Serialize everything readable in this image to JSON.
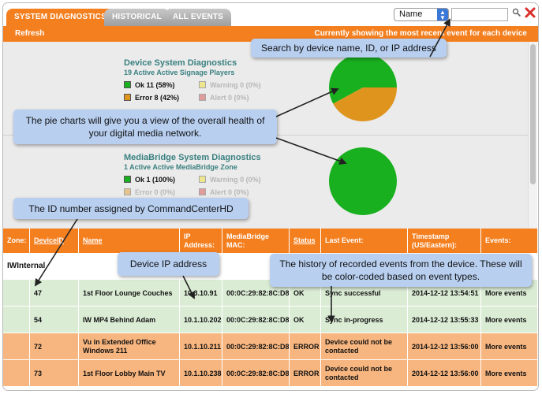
{
  "tabs": [
    {
      "label": "SYSTEM DIAGNOSTICS",
      "active": true
    },
    {
      "label": "HISTORICAL",
      "active": false
    },
    {
      "label": "ALL EVENTS",
      "active": false
    }
  ],
  "search": {
    "filter_selected": "Name",
    "value": ""
  },
  "toolbar": {
    "refresh_label": "Refresh",
    "showing_text": "Currently showing the most recent event for each device"
  },
  "device_diagnostics": {
    "title": "Device System Diagnostics",
    "subtitle": "19 Active Active Signage Players",
    "legend": [
      {
        "label": "Ok 11 (58%)",
        "color": "#19b01f"
      },
      {
        "label": "Warning 0 (0%)",
        "color": "#f3e21a"
      },
      {
        "label": "Error 8 (42%)",
        "color": "#df941d"
      },
      {
        "label": "Alert 0 (0%)",
        "color": "#d33b3b"
      }
    ],
    "pie": [
      {
        "name": "Ok",
        "value": 11,
        "color": "#19b01f"
      },
      {
        "name": "Error",
        "value": 8,
        "color": "#df941d"
      }
    ]
  },
  "mediabridge_diagnostics": {
    "title": "MediaBridge System Diagnostics",
    "subtitle": "1 Active Active MediaBridge Zone",
    "legend": [
      {
        "label": "Ok 1 (100%)",
        "color": "#19b01f"
      },
      {
        "label": "Warning 0 (0%)",
        "color": "#f3e21a"
      },
      {
        "label": "Error 0 (0%)",
        "color": "#df941d"
      },
      {
        "label": "Alert 0 (0%)",
        "color": "#d33b3b"
      }
    ],
    "pie": [
      {
        "name": "Ok",
        "value": 1,
        "color": "#19b01f"
      }
    ]
  },
  "table": {
    "headers": [
      "Zone:",
      "DeviceID",
      "Name",
      "IP Address:",
      "MediaBridge MAC:",
      "Status",
      "Last Event:",
      "Timestamp (US/Eastern):",
      "Events:"
    ],
    "zone": "IWInternal",
    "rows": [
      {
        "id": "47",
        "name": "1st Floor Lounge Couches",
        "ip": "10.3.10.91",
        "mac": "00:0C:29:82:8C:D8",
        "status": "OK",
        "event": "Sync successful",
        "timestamp": "2014-12-12 13:54:51",
        "events": "More events"
      },
      {
        "id": "54",
        "name": "IW MP4 Behind Adam",
        "ip": "10.1.10.202",
        "mac": "00:0C:29:82:8C:D8",
        "status": "OK",
        "event": "Sync in-progress",
        "timestamp": "2014-12-12 13:55:33",
        "events": "More events"
      },
      {
        "id": "72",
        "name": "Vu in Extended Office Windows 211",
        "ip": "10.1.10.211",
        "mac": "00:0C:29:82:8C:D8",
        "status": "ERROR",
        "event": "Device could not be contacted",
        "timestamp": "2014-12-12 13:56:00",
        "events": "More events"
      },
      {
        "id": "73",
        "name": "1st Floor Lobby Main TV",
        "ip": "10.1.10.238",
        "mac": "00:0C:29:82:8C:D8",
        "status": "ERROR",
        "event": "Device could not be contacted",
        "timestamp": "2014-12-12 13:56:00",
        "events": "More events"
      }
    ]
  },
  "callouts": {
    "search": "Search by device name, ID, or IP address",
    "pie": "The pie charts will give you a view of the overall health of your digital media network.",
    "id": "The ID number assigned by CommandCenterHD",
    "ip": "Device IP address",
    "history": "The history of recorded events from the device. These will be color-coded based on event types."
  }
}
